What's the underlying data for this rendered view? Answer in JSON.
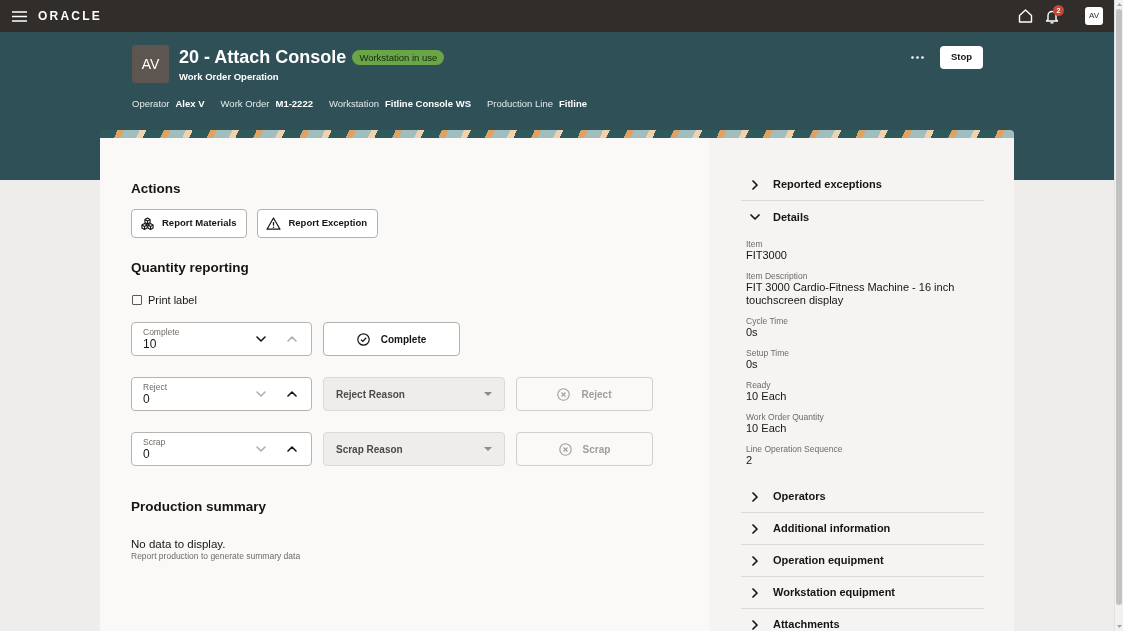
{
  "top_bar": {
    "logo": "ORACLE",
    "notification_count": "2",
    "user_initials": "AV"
  },
  "header": {
    "avatar_initials": "AV",
    "title": "20 - Attach Console",
    "status_badge": "Workstation in use",
    "subtitle": "Work Order Operation",
    "meta": [
      {
        "label": "Operator",
        "value": "Alex V"
      },
      {
        "label": "Work Order",
        "value": "M1-2222"
      },
      {
        "label": "Workstation",
        "value": "Fitline Console WS"
      },
      {
        "label": "Production Line",
        "value": "Fitline"
      }
    ],
    "stop_button": "Stop"
  },
  "actions": {
    "title": "Actions",
    "buttons": [
      {
        "label": "Report Materials"
      },
      {
        "label": "Report Exception"
      }
    ]
  },
  "quantity_reporting": {
    "title": "Quantity reporting",
    "print_label": {
      "label": "Print label",
      "checked": false
    },
    "rows": [
      {
        "kind": "complete",
        "field": {
          "label": "Complete",
          "value": "10",
          "can_decrease": true,
          "can_increase": false
        },
        "button": {
          "label": "Complete",
          "disabled": false
        }
      },
      {
        "kind": "reject",
        "field": {
          "label": "Reject",
          "value": "0",
          "can_decrease": false,
          "can_increase": true
        },
        "reason": {
          "placeholder": "Reject Reason",
          "disabled": true
        },
        "button": {
          "label": "Reject",
          "disabled": true
        }
      },
      {
        "kind": "scrap",
        "field": {
          "label": "Scrap",
          "value": "0",
          "can_decrease": false,
          "can_increase": true
        },
        "reason": {
          "placeholder": "Scrap Reason",
          "disabled": true
        },
        "button": {
          "label": "Scrap",
          "disabled": true
        }
      }
    ]
  },
  "production_summary": {
    "title": "Production summary",
    "empty_title": "No data to display.",
    "empty_hint": "Report production to generate summary data"
  },
  "side_panel": {
    "sections": [
      {
        "title": "Reported exceptions",
        "expanded": false
      },
      {
        "title": "Details",
        "expanded": true,
        "fields": [
          {
            "label": "Item",
            "value": "FIT3000"
          },
          {
            "label": "Item Description",
            "value": "FIT 3000 Cardio-Fitness Machine - 16 inch touchscreen display"
          },
          {
            "label": "Cycle Time",
            "value": "0s"
          },
          {
            "label": "Setup Time",
            "value": "0s"
          },
          {
            "label": "Ready",
            "value": "10 Each"
          },
          {
            "label": "Work Order Quantity",
            "value": "10 Each"
          },
          {
            "label": "Line Operation Sequence",
            "value": "2"
          }
        ]
      },
      {
        "title": "Operators",
        "expanded": false
      },
      {
        "title": "Additional information",
        "expanded": false
      },
      {
        "title": "Operation equipment",
        "expanded": false
      },
      {
        "title": "Workstation equipment",
        "expanded": false
      },
      {
        "title": "Attachments",
        "expanded": false
      }
    ]
  }
}
